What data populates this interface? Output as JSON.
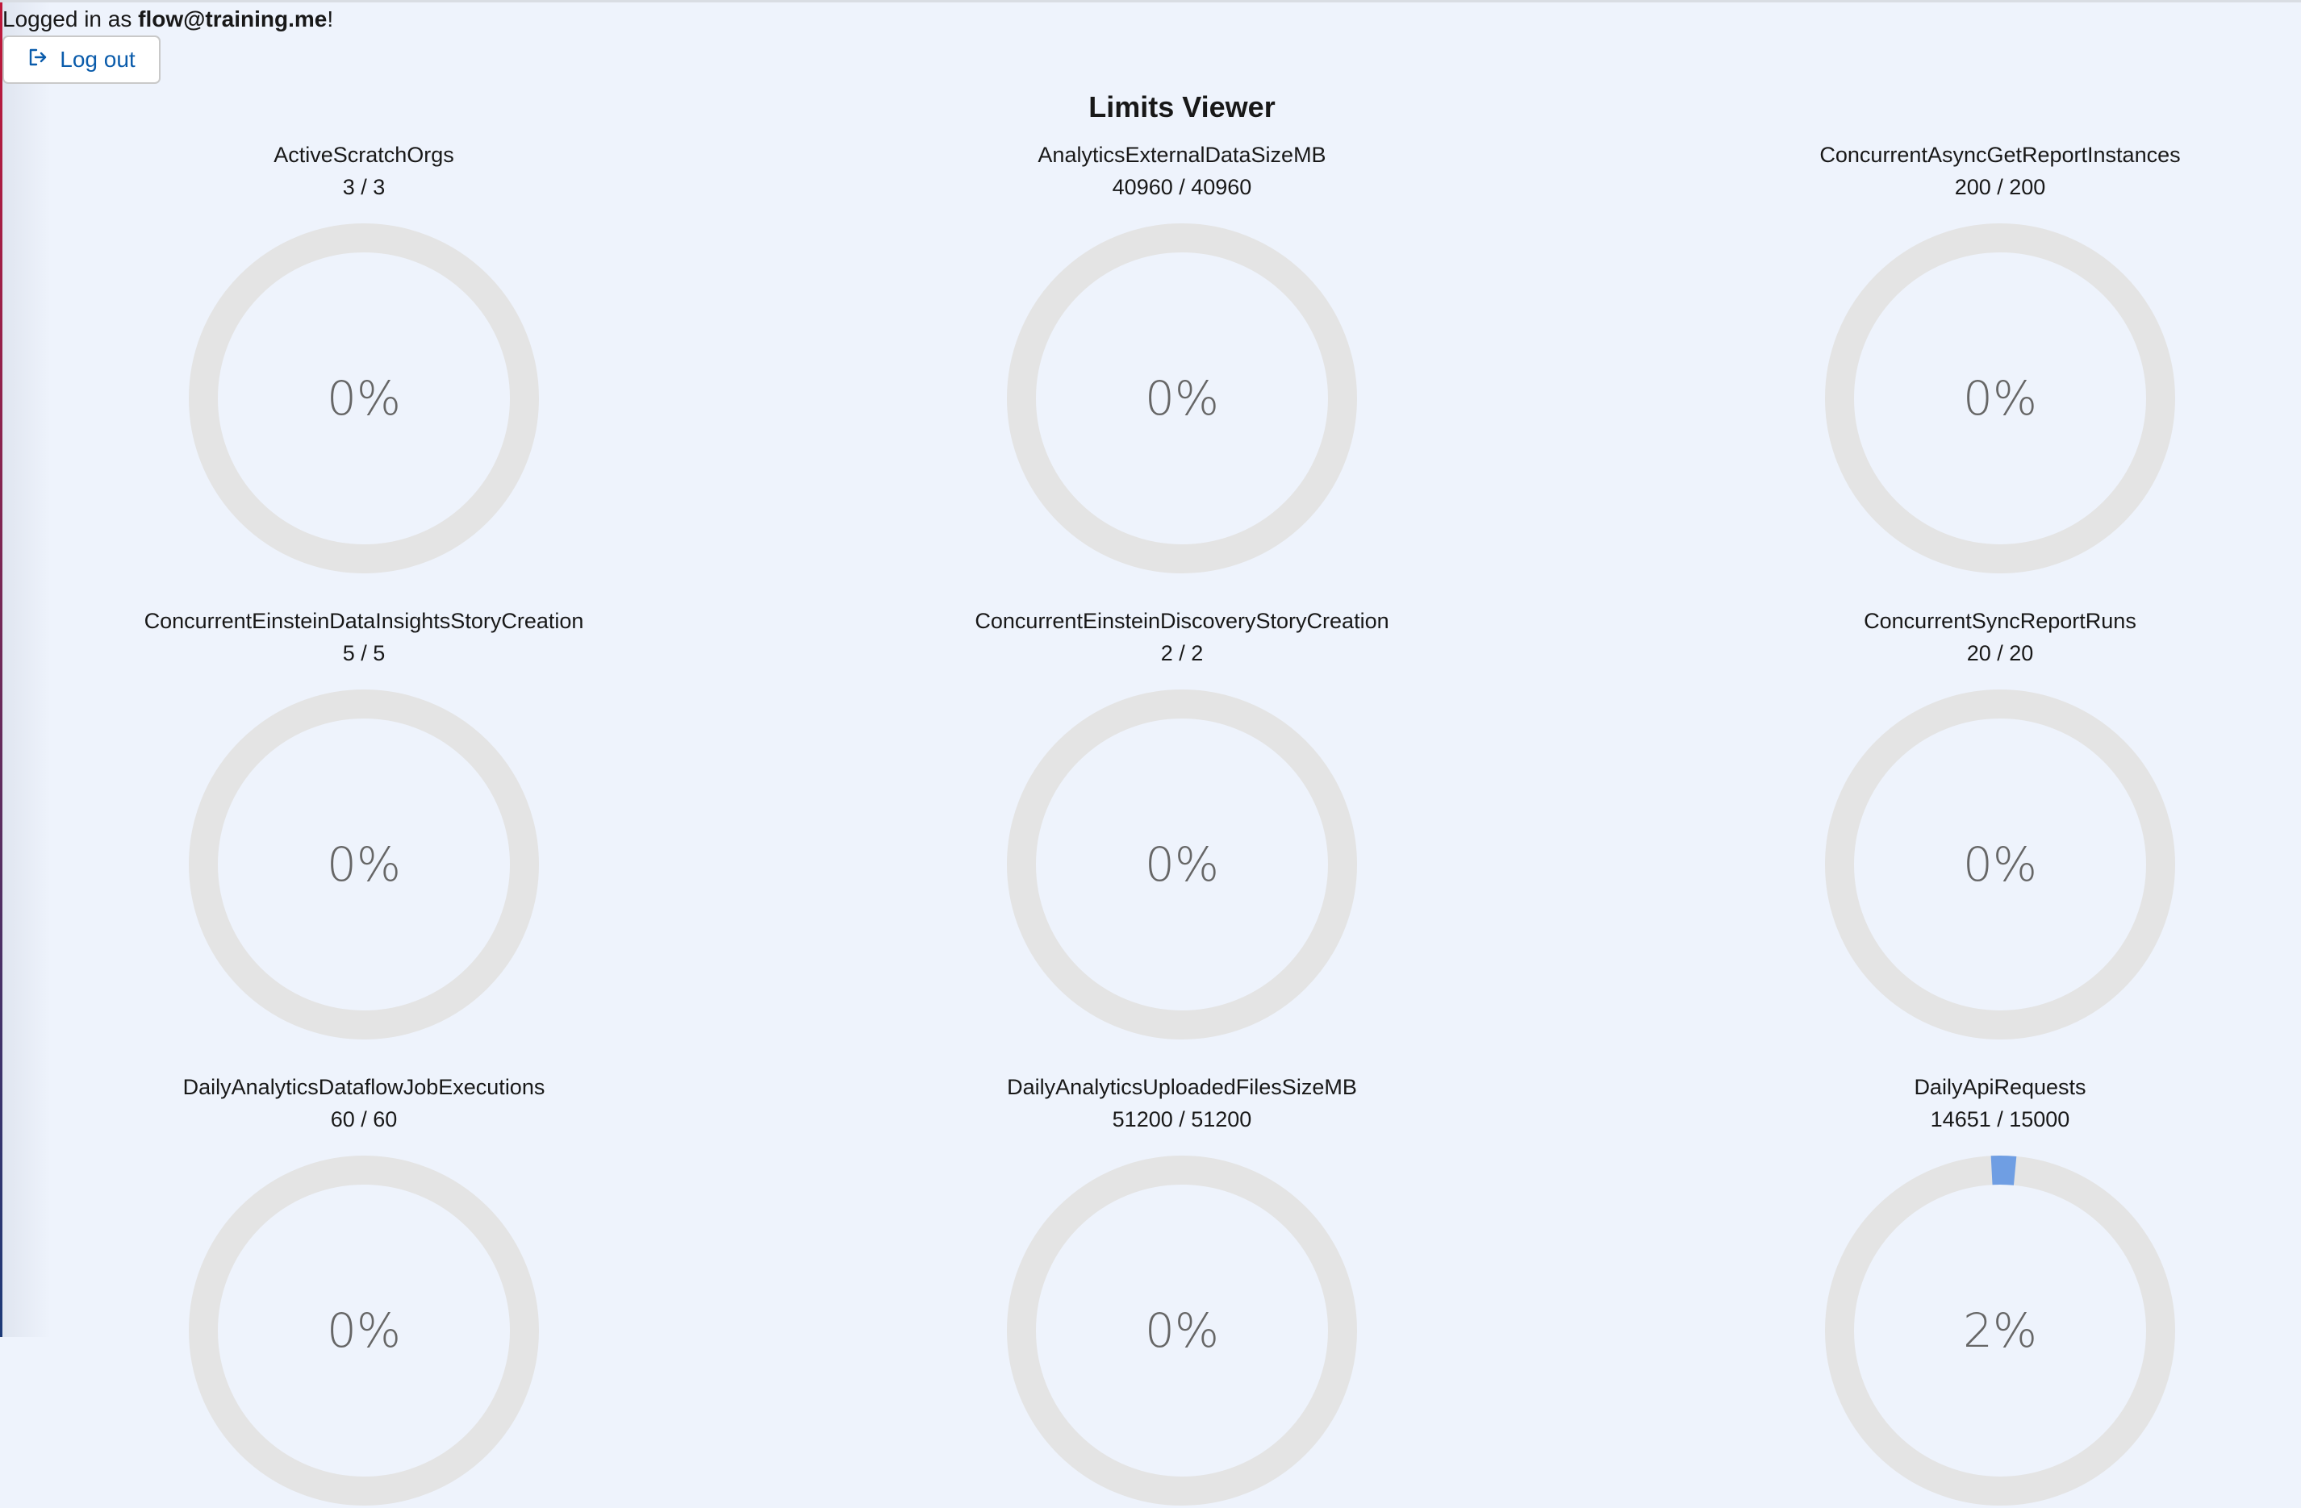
{
  "session": {
    "prefix": "Logged in as ",
    "user": "flow@training.me",
    "suffix": "!",
    "logout_label": "Log out",
    "logout_icon": "logout-icon"
  },
  "title": "Limits Viewer",
  "colors": {
    "background": "#eef3fc",
    "track": "#e4e4e4",
    "usage": "#6f9ee3",
    "button_text": "#0b5cab"
  },
  "limits": [
    {
      "name": "ActiveScratchOrgs",
      "value_text": "3 / 3",
      "percent_label": "0%",
      "used_fraction": 0
    },
    {
      "name": "AnalyticsExternalDataSizeMB",
      "value_text": "40960 / 40960",
      "percent_label": "0%",
      "used_fraction": 0
    },
    {
      "name": "ConcurrentAsyncGetReportInstances",
      "value_text": "200 / 200",
      "percent_label": "0%",
      "used_fraction": 0
    },
    {
      "name": "ConcurrentEinsteinDataInsightsStoryCreation",
      "value_text": "5 / 5",
      "percent_label": "0%",
      "used_fraction": 0
    },
    {
      "name": "ConcurrentEinsteinDiscoveryStoryCreation",
      "value_text": "2 / 2",
      "percent_label": "0%",
      "used_fraction": 0
    },
    {
      "name": "ConcurrentSyncReportRuns",
      "value_text": "20 / 20",
      "percent_label": "0%",
      "used_fraction": 0
    },
    {
      "name": "DailyAnalyticsDataflowJobExecutions",
      "value_text": "60 / 60",
      "percent_label": "0%",
      "used_fraction": 0
    },
    {
      "name": "DailyAnalyticsUploadedFilesSizeMB",
      "value_text": "51200 / 51200",
      "percent_label": "0%",
      "used_fraction": 0
    },
    {
      "name": "DailyApiRequests",
      "value_text": "14651 / 15000",
      "percent_label": "2%",
      "used_fraction": 0.0233
    }
  ]
}
